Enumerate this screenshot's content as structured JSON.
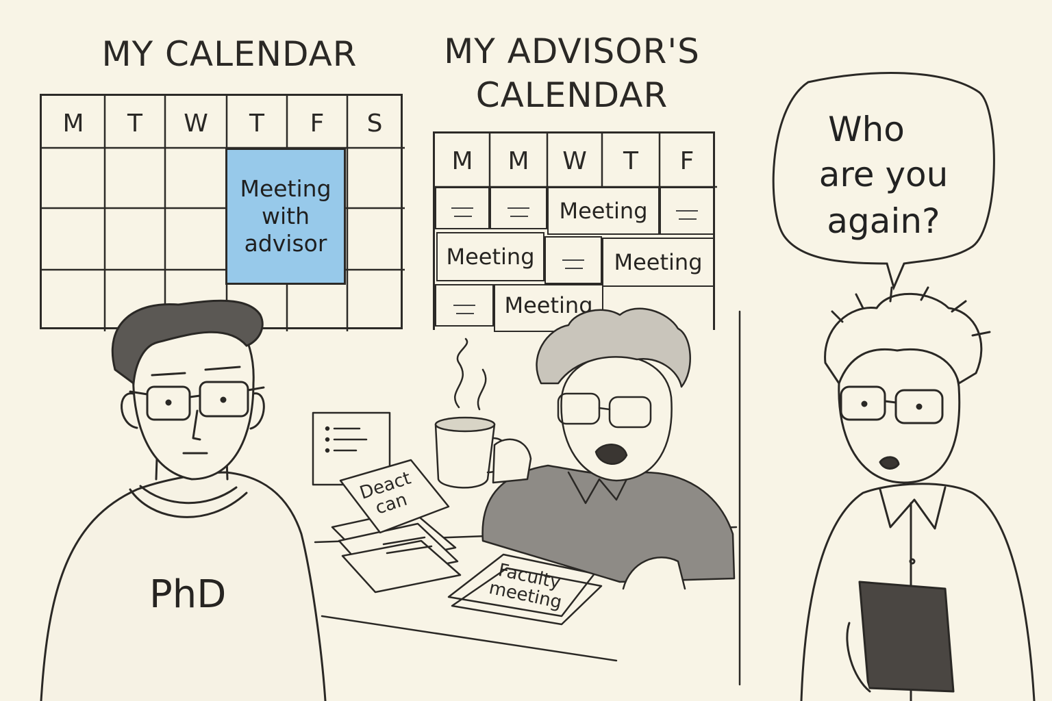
{
  "panel_left": {
    "title": "MY CALENDAR",
    "days": [
      "M",
      "T",
      "W",
      "T",
      "F",
      "S"
    ],
    "event": "Meeting with advisor",
    "shirt_text": "PhD"
  },
  "panel_middle": {
    "title_line1": "MY ADVISOR'S",
    "title_line2": "CALENDAR",
    "days": [
      "M",
      "M",
      "W",
      "T",
      "F"
    ],
    "meeting_label": "Meeting",
    "note_paper": "Deact can",
    "note_faculty": "Faculty meeting"
  },
  "panel_right": {
    "speech_line1": "Who",
    "speech_line2": "are you",
    "speech_line3": "again?"
  },
  "colors": {
    "background": "#f8f4e6",
    "event_blue": "#97c9ea",
    "ink": "#2c2a27"
  }
}
